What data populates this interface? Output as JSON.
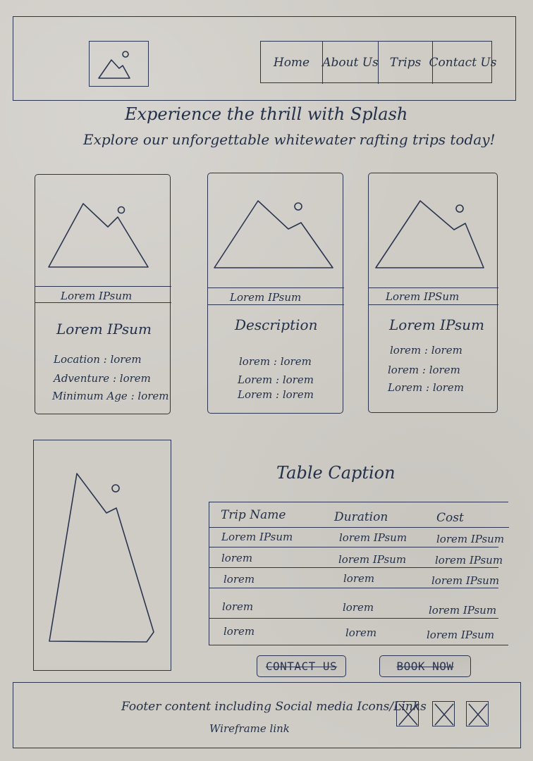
{
  "header": {
    "nav": [
      {
        "label": "Home"
      },
      {
        "label": "About Us"
      },
      {
        "label": "Trips"
      },
      {
        "label": "Contact Us"
      }
    ]
  },
  "hero": {
    "title": "Experience   the   thrill   with   Splash",
    "subtitle": "Explore our unforgettable whitewater rafting trips today!"
  },
  "cards": [
    {
      "caption": "Lorem   IPsum",
      "title": "Lorem  IPsum",
      "lines": [
        "Location :  lorem",
        "Adventure :  lorem",
        "Minimum Age : lorem"
      ]
    },
    {
      "caption": "Lorem   IPsum",
      "title": "Description",
      "lines": [
        "lorem : lorem",
        "Lorem : lorem",
        "Lorem : lorem"
      ]
    },
    {
      "caption": "Lorem  IPSum",
      "title": "Lorem  IPsum",
      "lines": [
        "lorem : lorem",
        "lorem : lorem",
        "Lorem : lorem"
      ]
    }
  ],
  "table": {
    "caption": "Table   Caption",
    "headers": [
      "Trip Name",
      "Duration",
      "Cost"
    ],
    "rows": [
      [
        "Lorem IPsum",
        "lorem IPsum",
        "lorem IPsum"
      ],
      [
        "lorem",
        "lorem IPsum",
        "lorem IPsum"
      ],
      [
        "lorem",
        "lorem",
        "lorem IPsum"
      ],
      [
        "lorem",
        "lorem",
        "lorem IPsum"
      ],
      [
        "lorem",
        "lorem",
        "lorem IPsum"
      ]
    ]
  },
  "buttons": {
    "contact_us": "CONTACT  US",
    "book_now": "BOOK  NOW"
  },
  "footer": {
    "line1": "Footer content including Social media Icons/Links",
    "line2": "Wireframe link"
  },
  "icons": {
    "logo": "image-placeholder-icon",
    "card_image": "image-placeholder-icon",
    "social": "social-placeholder-icon"
  },
  "colors": {
    "paper": "#cfccc6",
    "ink": "#233049"
  }
}
